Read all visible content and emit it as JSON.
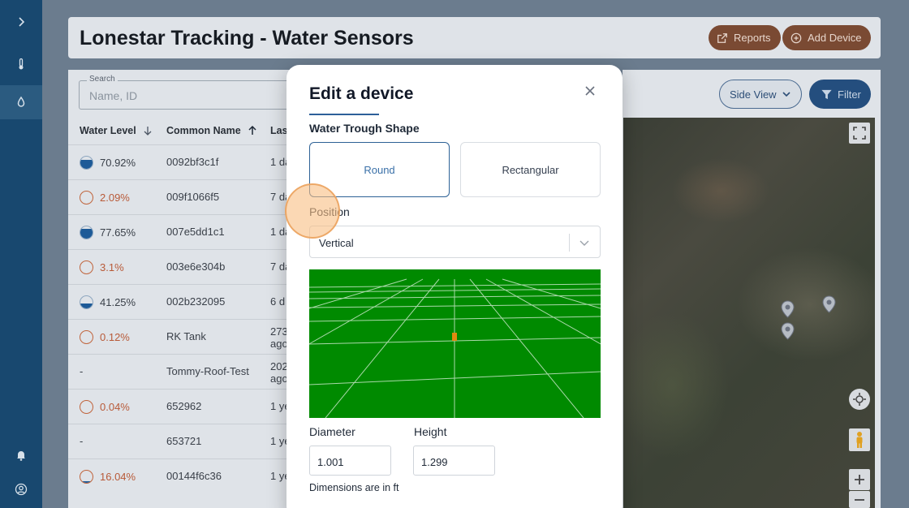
{
  "sidebar": {
    "items": [
      {
        "icon": "chevron-right-icon"
      },
      {
        "icon": "thermometer-icon"
      },
      {
        "icon": "water-drop-icon"
      },
      {
        "icon": "bell-icon"
      },
      {
        "icon": "user-circle-icon"
      }
    ]
  },
  "header": {
    "title": "Lonestar Tracking - Water Sensors",
    "reports_label": "Reports",
    "add_device_label": "Add Device"
  },
  "search": {
    "label": "Search",
    "placeholder": "Name, ID"
  },
  "table": {
    "columns": [
      "Water Level",
      "Common Name",
      "Las"
    ],
    "rows": [
      {
        "level": "70.92%",
        "level_fraction": 0.71,
        "low": false,
        "name": "0092bf3c1f",
        "last": [
          "1 da"
        ]
      },
      {
        "level": "2.09%",
        "level_fraction": 0.02,
        "low": true,
        "name": "009f1066f5",
        "last": [
          "7 da"
        ]
      },
      {
        "level": "77.65%",
        "level_fraction": 0.78,
        "low": false,
        "name": "007e5dd1c1",
        "last": [
          "1 da"
        ]
      },
      {
        "level": "3.1%",
        "level_fraction": 0.03,
        "low": true,
        "name": "003e6e304b",
        "last": [
          "7 da"
        ]
      },
      {
        "level": "41.25%",
        "level_fraction": 0.41,
        "low": false,
        "name": "002b232095",
        "last": [
          "6 d"
        ]
      },
      {
        "level": "0.12%",
        "level_fraction": 0.0,
        "low": true,
        "name": "RK Tank",
        "last": [
          "273",
          "ago"
        ]
      },
      {
        "level": "-",
        "level_fraction": null,
        "low": false,
        "name": "Tommy-Roof-Test",
        "last": [
          "202",
          "ago"
        ]
      },
      {
        "level": "0.04%",
        "level_fraction": 0.0,
        "low": true,
        "name": "652962",
        "last": [
          "1 ye"
        ]
      },
      {
        "level": "-",
        "level_fraction": null,
        "low": false,
        "name": "653721",
        "last": [
          "1 ye"
        ]
      },
      {
        "level": "16.04%",
        "level_fraction": 0.16,
        "low": true,
        "name": "00144f6c36",
        "last": [
          "1 ye"
        ]
      }
    ]
  },
  "toolbar": {
    "side_view_label": "Side View",
    "filter_label": "Filter"
  },
  "modal": {
    "title": "Edit a device",
    "shape_section": "Water Trough Shape",
    "shape_options": [
      "Round",
      "Rectangular"
    ],
    "selected_shape": "Round",
    "position_label": "Position",
    "position_value": "Vertical",
    "diameter_label": "Diameter",
    "diameter_value": "1.001",
    "height_label": "Height",
    "height_value": "1.299",
    "units_note": "Dimensions are in ft"
  },
  "colors": {
    "sidebar": "#18486f",
    "accent_brown": "#7a4a33",
    "selected_blue": "#2d6196",
    "preview_green": "#008a00",
    "low_level": "#b85a38"
  }
}
